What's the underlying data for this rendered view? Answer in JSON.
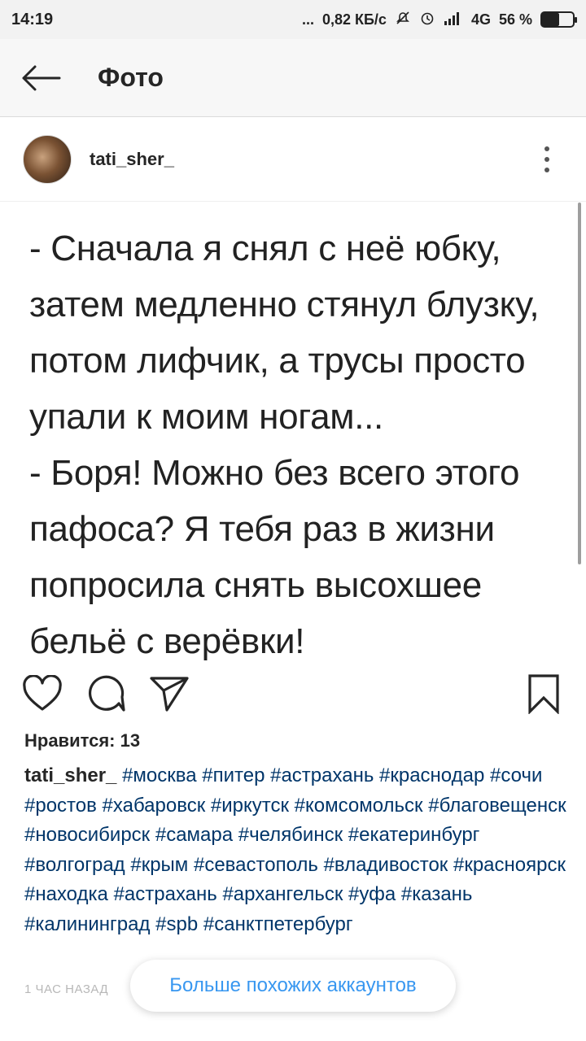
{
  "status_bar": {
    "time": "14:19",
    "dots": "...",
    "speed": "0,82 КБ/с",
    "network": "4G",
    "battery": "56 %",
    "battery_level": 0.56
  },
  "header": {
    "title": "Фото",
    "back_icon": "arrow-left-icon"
  },
  "post": {
    "username": "tati_sher_",
    "menu_icon": "more-vertical-icon",
    "photo_text": "- Сначала я снял с неё юбку,\nзатем медленно стянул блузку,\nпотом лифчик, а трусы просто\nупали к моим ногам...\n- Боря! Можно без всего этого\nпафоса? Я тебя раз в жизни\nпопросила снять высохшее\nбельё с верёвки!",
    "actions": {
      "like_icon": "heart-icon",
      "comment_icon": "comment-icon",
      "share_icon": "send-icon",
      "save_icon": "bookmark-icon"
    },
    "likes_text": "Нравится: 13",
    "caption_user": "tati_sher_",
    "hashtags": [
      "#москва",
      "#питер",
      "#астрахань",
      "#краснодар",
      "#сочи",
      "#ростов",
      "#хабаровск",
      "#иркутск",
      "#комсомольск",
      "#благовещенск",
      "#новосибирск",
      "#самара",
      "#челябинск",
      "#екатеринбург",
      "#волгоград",
      "#крым",
      "#севастополь",
      "#владивосток",
      "#красноярск",
      "#находка",
      "#астрахань",
      "#архангельск",
      "#уфа",
      "#казань",
      "#калининград",
      "#spb",
      "#санктпетербург"
    ],
    "timestamp": "1 ЧАС НАЗАД"
  },
  "similar_accounts_button": "Больше похожих аккаунтов",
  "colors": {
    "hashtag": "#003569",
    "link_blue": "#3897f0",
    "text": "#262626"
  }
}
